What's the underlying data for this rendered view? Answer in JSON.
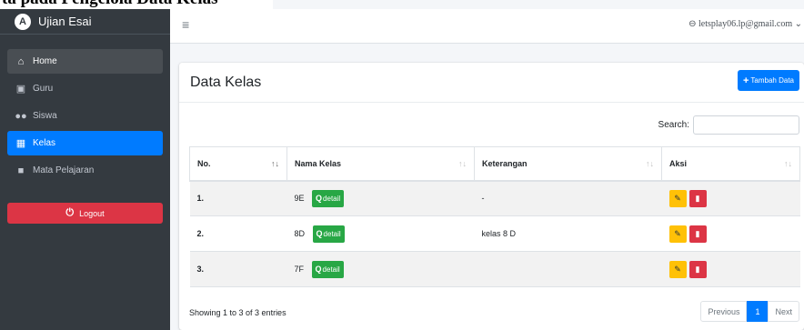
{
  "doc_title": "ta pada Pengelola Data Kelas",
  "brand": {
    "logo": "A",
    "name": "Ujian Esai"
  },
  "sidebar": {
    "items": [
      {
        "label": "Home",
        "icon": "home-icon"
      },
      {
        "label": "Guru",
        "icon": "chalkboard-teacher-icon"
      },
      {
        "label": "Siswa",
        "icon": "users-icon"
      },
      {
        "label": "Kelas",
        "icon": "building-icon"
      },
      {
        "label": "Mata Pelajaran",
        "icon": "book-icon"
      }
    ],
    "logout": "Logout"
  },
  "topbar": {
    "user_email": "letsplay06.lp@gmail.com"
  },
  "card": {
    "title": "Data Kelas",
    "add_label": "Tambah Data",
    "search_label": "Search:",
    "search_value": ""
  },
  "table": {
    "headers": [
      "No.",
      "Nama Kelas",
      "Keterangan",
      "Aksi"
    ],
    "detail_label": "detail",
    "rows": [
      {
        "no": "1.",
        "nama": "9E",
        "keterangan": "-"
      },
      {
        "no": "2.",
        "nama": "8D",
        "keterangan": "kelas 8 D"
      },
      {
        "no": "3.",
        "nama": "7F",
        "keterangan": ""
      }
    ]
  },
  "footer": {
    "info": "Showing 1 to 3 of 3 entries",
    "previous": "Previous",
    "current_page": "1",
    "next": "Next"
  },
  "colors": {
    "primary": "#007bff",
    "success": "#28a745",
    "danger": "#dc3545",
    "warning": "#ffc107",
    "sidebar": "#343a40"
  }
}
